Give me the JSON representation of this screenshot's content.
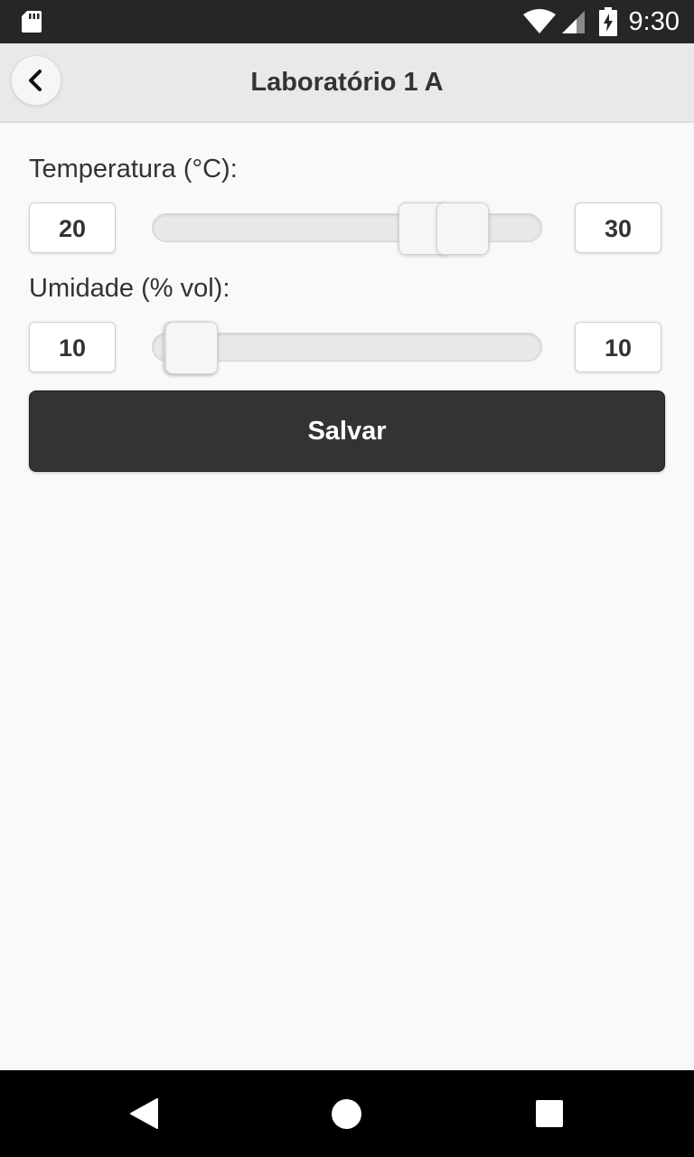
{
  "status_bar": {
    "time": "9:30",
    "icons": [
      "sd-card-icon",
      "wifi-icon",
      "cell-signal-icon",
      "battery-charging-icon"
    ]
  },
  "header": {
    "title": "Laboratório 1 A",
    "back_icon": "chevron-left-icon"
  },
  "temperature": {
    "label": "Temperatura (°C):",
    "min_value": "20",
    "max_value": "30"
  },
  "humidity": {
    "label": "Umidade (% vol):",
    "min_value": "10",
    "max_value": "10"
  },
  "save_button": {
    "label": "Salvar"
  },
  "nav_bar": {
    "icons": [
      "nav-back-icon",
      "nav-home-icon",
      "nav-recents-icon"
    ]
  },
  "colors": {
    "header_bg": "#e9e9e9",
    "button_bg": "#333333",
    "page_bg": "#f9f9f9"
  }
}
